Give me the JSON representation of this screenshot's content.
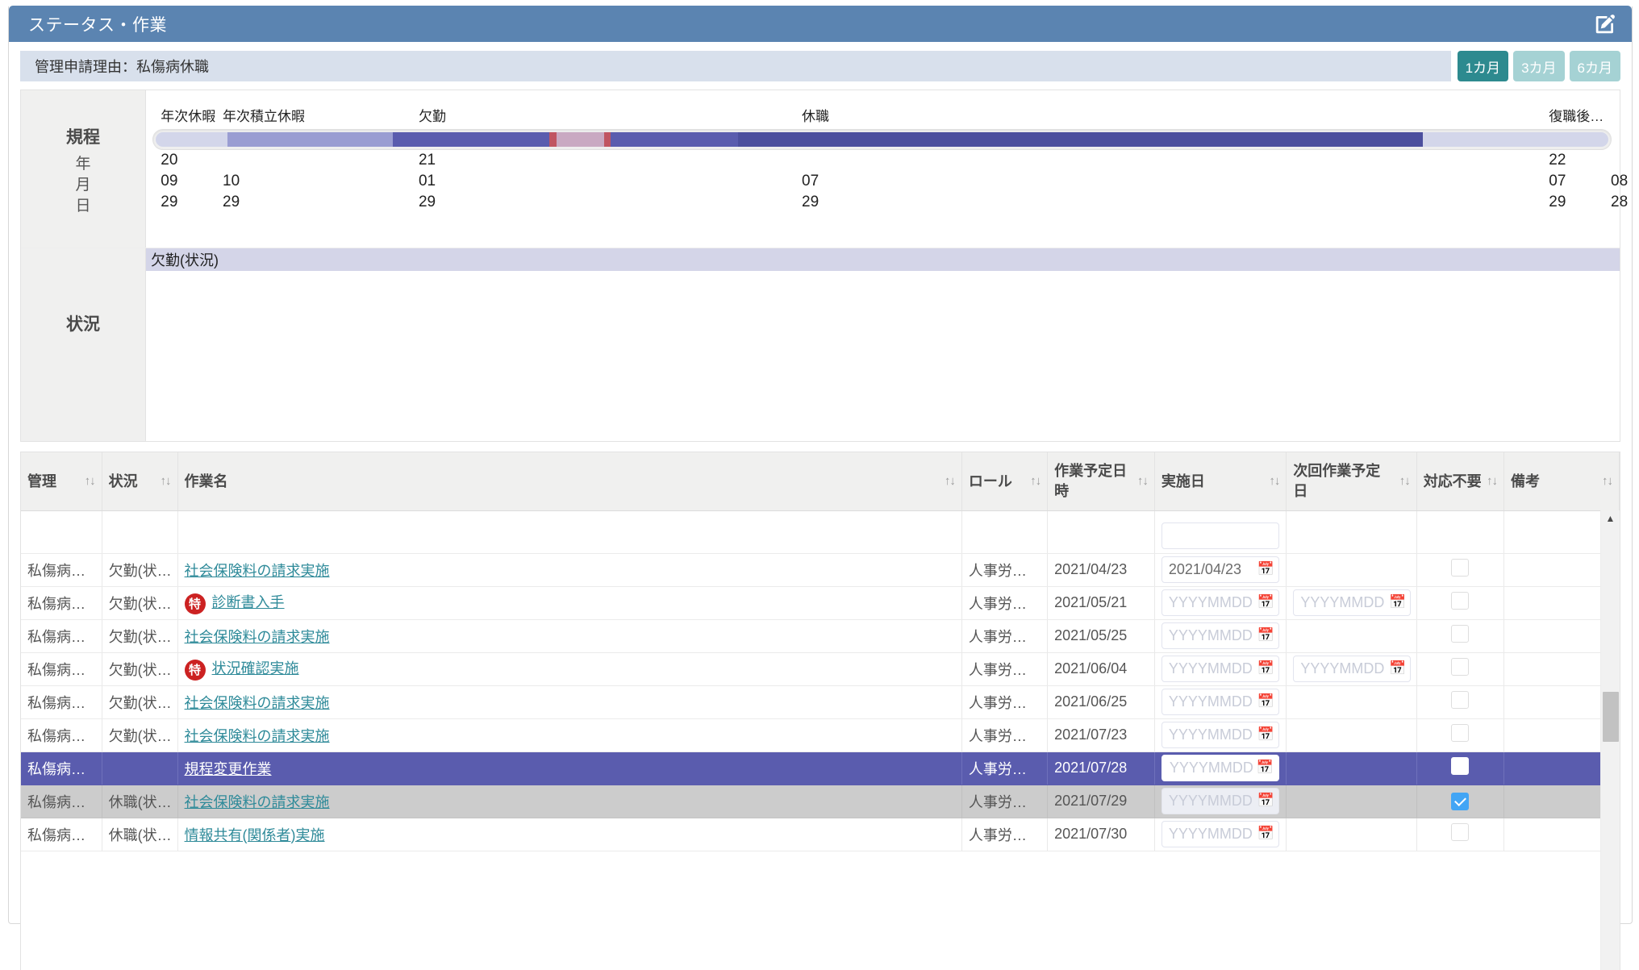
{
  "window": {
    "title": "ステータス・作業",
    "edit_icon": "edit-pencil-square-icon"
  },
  "reason": {
    "text": "管理申請理由：私傷病休職",
    "period_buttons": [
      {
        "label": "1カ月",
        "active": true
      },
      {
        "label": "3カ月",
        "active": false
      },
      {
        "label": "6カ月",
        "active": false
      }
    ]
  },
  "timeline": {
    "row_labels": {
      "section": "規程",
      "year": "年",
      "month": "月",
      "day": "日"
    },
    "segment_labels": [
      {
        "text": "年次休暇",
        "left_pct": 1.0
      },
      {
        "text": "年次積立休暇",
        "left_pct": 5.2
      },
      {
        "text": "欠勤",
        "left_pct": 18.5
      },
      {
        "text": "休職",
        "left_pct": 44.5
      },
      {
        "text": "復職後…",
        "left_pct": 95.2
      }
    ],
    "segments": [
      {
        "name": "pre",
        "width_pct": 5.4,
        "color": "#d3d6ea"
      },
      {
        "name": "年次休暇",
        "width_pct": 12.5,
        "color": "#9a9dd2"
      },
      {
        "name": "欠勤",
        "width_pct": 11.8,
        "color": "#5a5cae"
      },
      {
        "name": "欠勤-marker-a",
        "width_pct": 0.5,
        "color": "#c05562"
      },
      {
        "name": "欠勤-highlight",
        "width_pct": 3.6,
        "color": "#c9a9c2"
      },
      {
        "name": "欠勤-marker-b",
        "width_pct": 0.5,
        "color": "#c05562"
      },
      {
        "name": "欠勤-tail",
        "width_pct": 9.6,
        "color": "#5a5cae"
      },
      {
        "name": "休職",
        "width_pct": 51.6,
        "color": "#4c4f9e"
      },
      {
        "name": "復職後",
        "width_pct": 14.0,
        "color": "#d3d6ea"
      }
    ],
    "dates": [
      {
        "year": "20",
        "month": "09",
        "day": "29",
        "left_pct": 1.0
      },
      {
        "year": "",
        "month": "10",
        "day": "29",
        "left_pct": 5.2
      },
      {
        "year": "21",
        "month": "01",
        "day": "29",
        "left_pct": 18.5
      },
      {
        "year": "",
        "month": "07",
        "day": "29",
        "left_pct": 44.5
      },
      {
        "year": "22",
        "month": "07",
        "day": "29",
        "left_pct": 95.2
      },
      {
        "year": "",
        "month": "08",
        "day": "28",
        "left_pct": 99.4
      }
    ],
    "status_section_label": "状況",
    "status_band_text": "欠勤(状況)"
  },
  "table": {
    "columns": [
      {
        "label": "管理",
        "sortable": true
      },
      {
        "label": "状況",
        "sortable": true
      },
      {
        "label": "作業名",
        "sortable": true
      },
      {
        "label": "ロール",
        "sortable": true
      },
      {
        "label": "作業予定日時",
        "sortable": true
      },
      {
        "label": "実施日",
        "sortable": true
      },
      {
        "label": "次回作業予定日",
        "sortable": true
      },
      {
        "label": "対応不要",
        "sortable": true
      },
      {
        "label": "備考",
        "sortable": true
      }
    ],
    "date_placeholder": "YYYYMMDD",
    "rows": [
      {
        "kanri": "私傷病…",
        "joukyou": "欠勤(状…",
        "badge": "",
        "task": "社会保険料の請求実施",
        "role": "人事労…",
        "planned": "2021/04/23",
        "jisshi_value": "2021/04/23",
        "jisshi_has_input": true,
        "next_has_input": false,
        "next_value": "",
        "checkbox": false,
        "checked": false,
        "bikou": "",
        "state": "normal",
        "focused": false
      },
      {
        "kanri": "私傷病…",
        "joukyou": "欠勤(状…",
        "badge": "特",
        "task": "診断書入手",
        "role": "人事労…",
        "planned": "2021/05/21",
        "jisshi_value": "",
        "jisshi_has_input": true,
        "next_has_input": true,
        "next_value": "",
        "checkbox": false,
        "checked": false,
        "bikou": "",
        "state": "normal",
        "focused": false
      },
      {
        "kanri": "私傷病…",
        "joukyou": "欠勤(状…",
        "badge": "",
        "task": "社会保険料の請求実施",
        "role": "人事労…",
        "planned": "2021/05/25",
        "jisshi_value": "",
        "jisshi_has_input": true,
        "next_has_input": false,
        "next_value": "",
        "checkbox": false,
        "checked": false,
        "bikou": "",
        "state": "normal",
        "focused": false
      },
      {
        "kanri": "私傷病…",
        "joukyou": "欠勤(状…",
        "badge": "特",
        "task": "状況確認実施",
        "role": "人事労…",
        "planned": "2021/06/04",
        "jisshi_value": "",
        "jisshi_has_input": true,
        "next_has_input": true,
        "next_value": "",
        "checkbox": false,
        "checked": false,
        "bikou": "",
        "state": "normal",
        "focused": false
      },
      {
        "kanri": "私傷病…",
        "joukyou": "欠勤(状…",
        "badge": "",
        "task": "社会保険料の請求実施",
        "role": "人事労…",
        "planned": "2021/06/25",
        "jisshi_value": "",
        "jisshi_has_input": true,
        "next_has_input": false,
        "next_value": "",
        "checkbox": false,
        "checked": false,
        "bikou": "",
        "state": "normal",
        "focused": false
      },
      {
        "kanri": "私傷病…",
        "joukyou": "欠勤(状…",
        "badge": "",
        "task": "社会保険料の請求実施",
        "role": "人事労…",
        "planned": "2021/07/23",
        "jisshi_value": "",
        "jisshi_has_input": true,
        "next_has_input": false,
        "next_value": "",
        "checkbox": false,
        "checked": false,
        "bikou": "",
        "state": "normal",
        "focused": false
      },
      {
        "kanri": "私傷病…",
        "joukyou": "",
        "badge": "",
        "task": "規程変更作業",
        "role": "人事労…",
        "planned": "2021/07/28",
        "jisshi_value": "",
        "jisshi_has_input": true,
        "next_has_input": false,
        "next_value": "",
        "checkbox": true,
        "checked": false,
        "bikou": "",
        "state": "selected",
        "focused": true
      },
      {
        "kanri": "私傷病…",
        "joukyou": "休職(状…",
        "badge": "",
        "task": "社会保険料の請求実施",
        "role": "人事労…",
        "planned": "2021/07/29",
        "jisshi_value": "",
        "jisshi_has_input": true,
        "next_has_input": false,
        "next_value": "",
        "checkbox": true,
        "checked": true,
        "bikou": "",
        "state": "gray",
        "focused": false
      },
      {
        "kanri": "私傷病…",
        "joukyou": "休職(状…",
        "badge": "",
        "task": "情報共有(関係者)実施",
        "role": "人事労…",
        "planned": "2021/07/30",
        "jisshi_value": "",
        "jisshi_has_input": true,
        "next_has_input": false,
        "next_value": "",
        "checkbox": true,
        "checked": false,
        "bikou": "",
        "state": "normal",
        "focused": false
      }
    ],
    "scrollbar": {
      "up_arrow": "▲"
    }
  },
  "colors": {
    "header_blue": "#5b84b1",
    "reason_bg": "#d8e0ec",
    "period_active": "#2d8a8f",
    "period_inactive": "#a5d2d4",
    "selected_row": "#5a5cae",
    "gray_row": "#cccccc",
    "link": "#2e8a99",
    "badge_red": "#cc2222",
    "checkbox_checked": "#42a5f5",
    "status_band": "#d4d5e8"
  }
}
